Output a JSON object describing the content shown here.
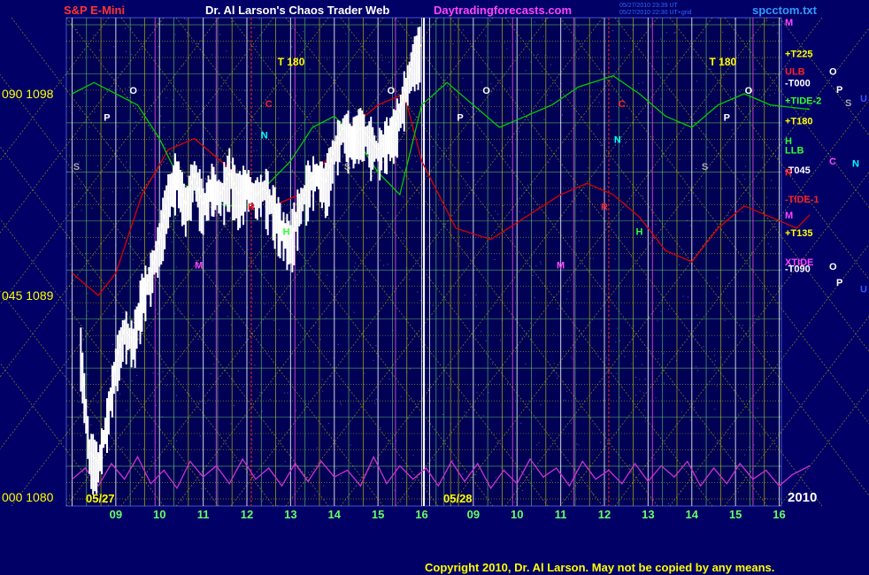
{
  "header": {
    "left_title": "S&P E-Mini",
    "center_title": "Dr. Al Larson's Chaos Trader Web",
    "site": "Daytradingforecasts.com",
    "timestamp_1": "05/27/2010 23:39 UT",
    "timestamp_2": "05/27/2010 22:30 UT+grid",
    "file": "spcctom.txt"
  },
  "footer": {
    "copyright": "Copyright 2010, Dr. Al Larson. May not be copied by any means."
  },
  "year_label": "2010",
  "colors": {
    "background": "#000066",
    "price_bars": "#ffffff",
    "tide_1": "#dd0000",
    "tide_2": "#00cc00",
    "xtide": "#cc33cc",
    "trend": "#ffff00",
    "grid_yellow": "#cccc00",
    "grid_green": "#66cc66",
    "grid_magenta": "#cc66cc"
  },
  "chart_data": {
    "type": "line",
    "title": "S&P E-Mini",
    "ylim": [
      1080,
      1101
    ],
    "left_axis_ticks": [
      {
        "value": 1098,
        "label": "090  1098"
      },
      {
        "value": 1089,
        "label": "045  1089"
      },
      {
        "value": 1080,
        "label": "000  1080"
      }
    ],
    "x_hours": [
      {
        "hour": "09",
        "day": 1
      },
      {
        "hour": "10",
        "day": 1
      },
      {
        "hour": "11",
        "day": 1
      },
      {
        "hour": "12",
        "day": 1
      },
      {
        "hour": "13",
        "day": 1
      },
      {
        "hour": "14",
        "day": 1
      },
      {
        "hour": "15",
        "day": 1
      },
      {
        "hour": "16",
        "day": 1
      },
      {
        "hour": "09",
        "day": 2
      },
      {
        "hour": "10",
        "day": 2
      },
      {
        "hour": "11",
        "day": 2
      },
      {
        "hour": "12",
        "day": 2
      },
      {
        "hour": "13",
        "day": 2
      },
      {
        "hour": "14",
        "day": 2
      },
      {
        "hour": "15",
        "day": 2
      },
      {
        "hour": "16",
        "day": 2
      }
    ],
    "date_labels": [
      "05/27",
      "05/28"
    ],
    "right_labels": [
      {
        "text": "M",
        "color": "#ff44ff",
        "value": 1101.2
      },
      {
        "text": "+T225",
        "color": "#ffff00",
        "value": 1099.8
      },
      {
        "text": "ULB",
        "color": "#ff2222",
        "value": 1099.0
      },
      {
        "text": "-T000",
        "color": "#ffffff",
        "value": 1098.5
      },
      {
        "text": "+TIDE-2",
        "color": "#33ff33",
        "value": 1097.7
      },
      {
        "text": "+T180",
        "color": "#ffff00",
        "value": 1096.8
      },
      {
        "text": "H",
        "color": "#33ff33",
        "value": 1095.9
      },
      {
        "text": "LLB",
        "color": "#33ff33",
        "value": 1095.5
      },
      {
        "text": "-T045",
        "color": "#ffffff",
        "value": 1094.6
      },
      {
        "text": "R",
        "color": "#ff2222",
        "value": 1094.5
      },
      {
        "text": "-TIDE-1",
        "color": "#ff2222",
        "value": 1093.3
      },
      {
        "text": "M",
        "color": "#ff44ff",
        "value": 1092.6
      },
      {
        "text": "+T135",
        "color": "#ffff00",
        "value": 1091.8
      },
      {
        "text": "XTIDE",
        "color": "#ff44ff",
        "value": 1090.5
      },
      {
        "text": "-T090",
        "color": "#ffffff",
        "value": 1090.2
      }
    ],
    "far_right_letters": [
      {
        "text": "O",
        "color": "#ffffff",
        "value": 1099.0
      },
      {
        "text": "P",
        "color": "#ffffff",
        "value": 1098.2
      },
      {
        "text": "U",
        "color": "#3355ff",
        "value": 1097.8
      },
      {
        "text": "S",
        "color": "#aaaaaa",
        "value": 1097.6
      },
      {
        "text": "C",
        "color": "#ff44ff",
        "value": 1095.0
      },
      {
        "text": "N",
        "color": "#00ffff",
        "value": 1094.9
      },
      {
        "text": "O",
        "color": "#ffffff",
        "value": 1090.3
      },
      {
        "text": "P",
        "color": "#ffffff",
        "value": 1089.6
      },
      {
        "text": "U",
        "color": "#3355ff",
        "value": 1089.3
      }
    ],
    "planet_markers": [
      {
        "text": "O",
        "color": "#ffffff",
        "hour": 9.4,
        "value": 1098.0
      },
      {
        "text": "P",
        "color": "#ffffff",
        "hour": 8.8,
        "value": 1096.8
      },
      {
        "text": "C",
        "color": "#ff2222",
        "hour": 12.5,
        "value": 1097.4
      },
      {
        "text": "N",
        "color": "#00ffff",
        "hour": 12.4,
        "value": 1096.0
      },
      {
        "text": "S",
        "color": "#aaaaaa",
        "hour": 8.1,
        "value": 1094.6
      },
      {
        "text": "R",
        "color": "#ff2222",
        "hour": 12.1,
        "value": 1092.8
      },
      {
        "text": "H",
        "color": "#33ff33",
        "hour": 12.9,
        "value": 1091.7
      },
      {
        "text": "M",
        "color": "#ff44ff",
        "hour": 10.9,
        "value": 1090.2
      },
      {
        "text": "S",
        "color": "#aaaaaa",
        "hour": 14.3,
        "value": 1094.6
      },
      {
        "text": "O",
        "color": "#ffffff",
        "hour": 15.3,
        "value": 1098.0
      },
      {
        "text": "O",
        "color": "#ffffff",
        "hour": 9.3,
        "value": 1098.0,
        "day": 2
      },
      {
        "text": "P",
        "color": "#ffffff",
        "hour": 8.7,
        "value": 1096.8,
        "day": 2
      },
      {
        "text": "C",
        "color": "#ff2222",
        "hour": 12.4,
        "value": 1097.4,
        "day": 2
      },
      {
        "text": "N",
        "color": "#00ffff",
        "hour": 12.3,
        "value": 1095.8,
        "day": 2
      },
      {
        "text": "R",
        "color": "#ff2222",
        "hour": 12.0,
        "value": 1092.8,
        "day": 2
      },
      {
        "text": "H",
        "color": "#33ff33",
        "hour": 12.8,
        "value": 1091.7,
        "day": 2
      },
      {
        "text": "M",
        "color": "#ff44ff",
        "hour": 11.0,
        "value": 1090.2,
        "day": 2
      },
      {
        "text": "S",
        "color": "#aaaaaa",
        "hour": 14.3,
        "value": 1094.6,
        "day": 2
      },
      {
        "text": "P",
        "color": "#ffffff",
        "hour": 14.8,
        "value": 1096.8,
        "day": 2
      },
      {
        "text": "O",
        "color": "#ffffff",
        "hour": 15.3,
        "value": 1098.0,
        "day": 2
      }
    ],
    "t180_labels": [
      {
        "text": "T   180",
        "day": 1,
        "hour": 12.7
      },
      {
        "text": "T   180",
        "day": 2,
        "hour": 14.4
      }
    ],
    "series": [
      {
        "name": "price",
        "points": [
          [
            8.2,
            1086.5
          ],
          [
            8.4,
            1082.0
          ],
          [
            8.6,
            1081.5
          ],
          [
            8.8,
            1083.5
          ],
          [
            9.0,
            1086.0
          ],
          [
            9.2,
            1087.5
          ],
          [
            9.4,
            1087.0
          ],
          [
            9.6,
            1089.0
          ],
          [
            9.8,
            1090.0
          ],
          [
            10.0,
            1091.5
          ],
          [
            10.2,
            1093.5
          ],
          [
            10.4,
            1094.5
          ],
          [
            10.6,
            1093.0
          ],
          [
            10.8,
            1094.5
          ],
          [
            11.0,
            1093.0
          ],
          [
            11.2,
            1094.0
          ],
          [
            11.4,
            1093.5
          ],
          [
            11.6,
            1094.5
          ],
          [
            11.8,
            1093.5
          ],
          [
            12.0,
            1094.0
          ],
          [
            12.2,
            1093.5
          ],
          [
            12.4,
            1093.8
          ],
          [
            12.6,
            1093.0
          ],
          [
            12.8,
            1092.0
          ],
          [
            13.0,
            1091.5
          ],
          [
            13.2,
            1093.0
          ],
          [
            13.4,
            1094.0
          ],
          [
            13.6,
            1094.5
          ],
          [
            13.8,
            1094.0
          ],
          [
            14.0,
            1095.5
          ],
          [
            14.2,
            1096.5
          ],
          [
            14.4,
            1096.0
          ],
          [
            14.6,
            1096.5
          ],
          [
            14.8,
            1096.0
          ],
          [
            15.0,
            1095.5
          ],
          [
            15.2,
            1096.0
          ],
          [
            15.4,
            1096.5
          ],
          [
            15.6,
            1098.0
          ],
          [
            15.8,
            1099.5
          ],
          [
            16.0,
            1100.2
          ]
        ]
      },
      {
        "name": "TIDE-1",
        "points": [
          [
            8.0,
            1090.0
          ],
          [
            8.6,
            1089.0
          ],
          [
            9.0,
            1090.0
          ],
          [
            9.6,
            1093.5
          ],
          [
            10.2,
            1095.5
          ],
          [
            10.8,
            1096.0
          ],
          [
            11.4,
            1095.0
          ],
          [
            12.0,
            1094.0
          ],
          [
            12.6,
            1093.0
          ],
          [
            13.2,
            1093.5
          ],
          [
            13.8,
            1095.0
          ],
          [
            14.4,
            1096.5
          ],
          [
            15.0,
            1097.5
          ],
          [
            15.6,
            1098.0
          ],
          [
            16.0,
            1095.0
          ],
          [
            16.8,
            1092.0
          ],
          [
            17.6,
            1091.5
          ],
          [
            18.4,
            1092.5
          ],
          [
            19.2,
            1093.5
          ],
          [
            19.8,
            1094.0
          ],
          [
            20.4,
            1093.5
          ],
          [
            21.0,
            1092.5
          ],
          [
            21.6,
            1091.0
          ],
          [
            22.2,
            1090.5
          ],
          [
            22.8,
            1092.0
          ],
          [
            23.4,
            1093.0
          ],
          [
            24.0,
            1092.5
          ],
          [
            24.6,
            1092.0
          ],
          [
            24.9,
            1092.6
          ]
        ]
      },
      {
        "name": "TIDE-2",
        "points": [
          [
            8.0,
            1098.0
          ],
          [
            8.5,
            1098.5
          ],
          [
            9.0,
            1098.0
          ],
          [
            9.5,
            1097.5
          ],
          [
            10.0,
            1096.0
          ],
          [
            10.5,
            1094.0
          ],
          [
            11.0,
            1093.5
          ],
          [
            11.5,
            1093.0
          ],
          [
            12.0,
            1093.0
          ],
          [
            12.5,
            1094.0
          ],
          [
            13.0,
            1095.0
          ],
          [
            13.5,
            1096.5
          ],
          [
            14.0,
            1097.0
          ],
          [
            14.5,
            1096.0
          ],
          [
            15.0,
            1094.5
          ],
          [
            15.5,
            1093.5
          ],
          [
            16.0,
            1097.5
          ],
          [
            16.6,
            1098.5
          ],
          [
            17.2,
            1097.5
          ],
          [
            17.8,
            1096.5
          ],
          [
            18.4,
            1097.0
          ],
          [
            19.0,
            1097.5
          ],
          [
            19.6,
            1098.3
          ],
          [
            20.4,
            1098.8
          ],
          [
            21.0,
            1098.0
          ],
          [
            21.6,
            1097.0
          ],
          [
            22.2,
            1096.5
          ],
          [
            22.8,
            1097.5
          ],
          [
            23.4,
            1098.0
          ],
          [
            24.0,
            1097.5
          ],
          [
            24.9,
            1097.3
          ]
        ]
      },
      {
        "name": "XTIDE",
        "points": [
          [
            8.0,
            1080.8
          ],
          [
            8.3,
            1081.3
          ],
          [
            8.6,
            1080.5
          ],
          [
            8.9,
            1081.5
          ],
          [
            9.2,
            1080.8
          ],
          [
            9.5,
            1081.8
          ],
          [
            9.8,
            1080.6
          ],
          [
            10.1,
            1081.2
          ],
          [
            10.4,
            1080.4
          ],
          [
            10.7,
            1081.6
          ],
          [
            11.0,
            1080.9
          ],
          [
            11.3,
            1081.4
          ],
          [
            11.6,
            1080.6
          ],
          [
            11.9,
            1081.7
          ],
          [
            12.2,
            1080.8
          ],
          [
            12.5,
            1081.3
          ],
          [
            12.8,
            1080.5
          ],
          [
            13.1,
            1081.5
          ],
          [
            13.4,
            1080.7
          ],
          [
            13.7,
            1081.6
          ],
          [
            14.0,
            1080.9
          ],
          [
            14.3,
            1081.2
          ],
          [
            14.6,
            1080.5
          ],
          [
            14.9,
            1081.8
          ],
          [
            15.2,
            1080.6
          ],
          [
            15.5,
            1081.4
          ],
          [
            15.8,
            1080.8
          ],
          [
            16.1,
            1081.3
          ],
          [
            16.4,
            1080.5
          ],
          [
            16.7,
            1081.6
          ],
          [
            17.0,
            1080.7
          ],
          [
            17.3,
            1081.5
          ],
          [
            17.6,
            1080.4
          ],
          [
            17.9,
            1081.2
          ],
          [
            18.2,
            1080.6
          ],
          [
            18.5,
            1081.7
          ],
          [
            18.8,
            1080.9
          ],
          [
            19.1,
            1081.3
          ],
          [
            19.4,
            1080.5
          ],
          [
            19.7,
            1081.6
          ],
          [
            20.0,
            1080.8
          ],
          [
            20.3,
            1081.2
          ],
          [
            20.6,
            1080.6
          ],
          [
            20.9,
            1081.5
          ],
          [
            21.2,
            1080.7
          ],
          [
            21.5,
            1081.4
          ],
          [
            21.8,
            1080.9
          ],
          [
            22.1,
            1081.6
          ],
          [
            22.4,
            1080.5
          ],
          [
            22.7,
            1081.3
          ],
          [
            23.0,
            1080.6
          ],
          [
            23.3,
            1081.5
          ],
          [
            23.6,
            1080.8
          ],
          [
            23.9,
            1081.2
          ],
          [
            24.2,
            1080.5
          ],
          [
            24.5,
            1081.0
          ],
          [
            24.9,
            1081.4
          ]
        ]
      }
    ],
    "grid": true
  }
}
